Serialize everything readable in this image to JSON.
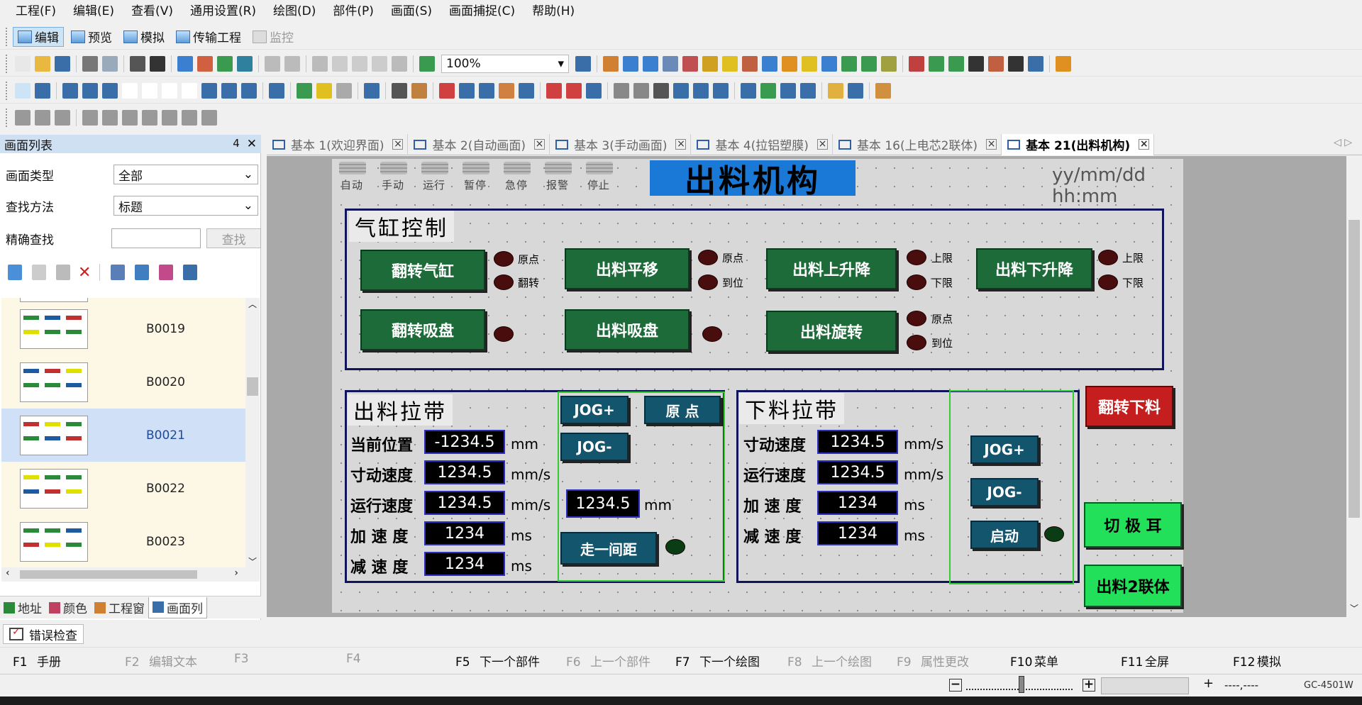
{
  "menu": [
    "工程(F)",
    "编辑(E)",
    "查看(V)",
    "通用设置(R)",
    "绘图(D)",
    "部件(P)",
    "画面(S)",
    "画面捕捉(C)",
    "帮助(H)"
  ],
  "modes": [
    {
      "label": "编辑",
      "active": true
    },
    {
      "label": "预览"
    },
    {
      "label": "模拟"
    },
    {
      "label": "传输工程"
    },
    {
      "label": "监控",
      "disabled": true
    }
  ],
  "zoom": "100%",
  "panel": {
    "title": "画面列表",
    "pin": "ꟷ",
    "close": "✕",
    "type_label": "画面类型",
    "type_value": "全部",
    "method_label": "查找方法",
    "method_value": "标题",
    "exact_label": "精确查找",
    "search_btn": "查找",
    "items": [
      "B0019",
      "B0020",
      "B0021",
      "B0022",
      "B0023"
    ],
    "selected_index": 2,
    "tabs": [
      "地址",
      "颜色",
      "工程窗",
      "画面列"
    ]
  },
  "doc_tabs": [
    {
      "label": "基本 1(欢迎界面)"
    },
    {
      "label": "基本 2(自动画面)"
    },
    {
      "label": "基本 3(手动画面)"
    },
    {
      "label": "基本 4(拉铝塑膜)"
    },
    {
      "label": "基本 16(上电芯2联体)"
    },
    {
      "label": "基本 21(出料机构)",
      "active": true
    }
  ],
  "screen": {
    "status_lamps": [
      "自动",
      "手动",
      "运行",
      "暂停",
      "急停",
      "报警",
      "停止"
    ],
    "title": "出料机构",
    "datetime": "yy/mm/dd hh:mm",
    "cylinder": {
      "title": "气缸控制",
      "buttons": [
        "翻转气缸",
        "出料平移",
        "出料上升降",
        "出料下升降",
        "翻转吸盘",
        "出料吸盘",
        "出料旋转"
      ],
      "lamp_labels": {
        "origin": "原点",
        "flip": "翻转",
        "reach": "到位",
        "upper": "上限",
        "lower": "下限"
      }
    },
    "out_belt": {
      "title": "出料拉带",
      "rows": [
        {
          "label": "当前位置",
          "value": "-1234.5",
          "unit": "mm"
        },
        {
          "label": "寸动速度",
          "value": "1234.5",
          "unit": "mm/s"
        },
        {
          "label": "运行速度",
          "value": "1234.5",
          "unit": "mm/s"
        },
        {
          "label": "加 速 度",
          "value": "1234",
          "unit": "ms"
        },
        {
          "label": "减 速 度",
          "value": "1234",
          "unit": "ms"
        }
      ],
      "jog_plus": "JOG+",
      "jog_minus": "JOG-",
      "origin": "原 点",
      "step_value": "1234.5",
      "step_unit": "mm",
      "step_btn": "走一间距"
    },
    "down_belt": {
      "title": "下料拉带",
      "rows": [
        {
          "label": "寸动速度",
          "value": "1234.5",
          "unit": "mm/s"
        },
        {
          "label": "运行速度",
          "value": "1234.5",
          "unit": "mm/s"
        },
        {
          "label": "加 速 度",
          "value": "1234",
          "unit": "ms"
        },
        {
          "label": "减 速 度",
          "value": "1234",
          "unit": "ms"
        }
      ],
      "jog_plus": "JOG+",
      "jog_minus": "JOG-",
      "start": "启动"
    },
    "flip_down": "翻转下料",
    "cut_tab": "切 极 耳",
    "out2": "出料2联体"
  },
  "error_tab": "错误检查",
  "fkeys": [
    {
      "key": "F1",
      "label": "手册"
    },
    {
      "key": "F2",
      "label": "编辑文本",
      "disabled": true
    },
    {
      "key": "F3",
      "label": "",
      "disabled": true
    },
    {
      "key": "F4",
      "label": "",
      "disabled": true
    },
    {
      "key": "F5",
      "label": "下一个部件"
    },
    {
      "key": "F6",
      "label": "上一个部件",
      "disabled": true
    },
    {
      "key": "F7",
      "label": "下一个绘图"
    },
    {
      "key": "F8",
      "label": "上一个绘图",
      "disabled": true
    },
    {
      "key": "F9",
      "label": "属性更改",
      "disabled": true
    },
    {
      "key": "F10",
      "label": "菜单"
    },
    {
      "key": "F11",
      "label": "全屏"
    },
    {
      "key": "F12",
      "label": "模拟"
    }
  ],
  "status": {
    "coords": "----,----",
    "model": "GC-4501W"
  }
}
